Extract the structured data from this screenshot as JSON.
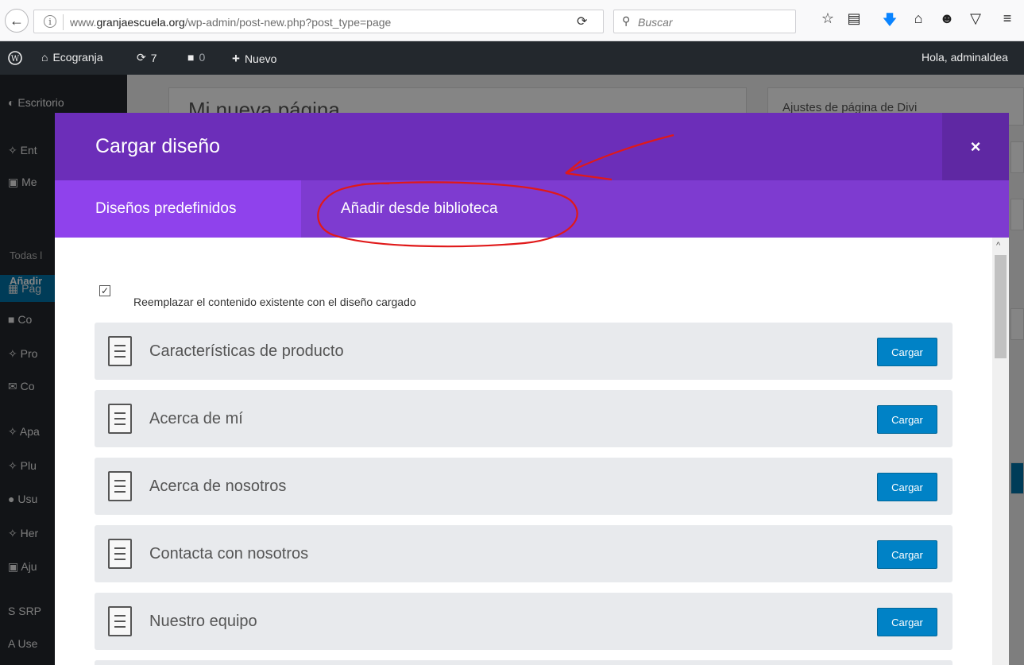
{
  "browser": {
    "url_prefix": "www.",
    "url_domain": "granjaescuela.org",
    "url_path": "/wp-admin/post-new.php?post_type=page",
    "search_placeholder": "Buscar"
  },
  "adminbar": {
    "site_name": "Ecogranja",
    "updates_count": "7",
    "comments_count": "0",
    "new_label": "Nuevo",
    "greeting": "Hola, adminaldea"
  },
  "underlay": {
    "page_title": "Mi nueva página",
    "side_box_title": "Ajustes de página de Divi",
    "sidebar": {
      "dashboard": "Escritorio",
      "posts": "Ent",
      "media": "Me",
      "pages": "Pág",
      "all_pages": "Todas l",
      "add_new": "Añadir",
      "comments": "Co",
      "projects": "Pro",
      "contact": "Co",
      "appearance": "Apa",
      "plugins": "Plu",
      "users": "Usu",
      "tools": "Her",
      "settings": "Aju",
      "srp": "SRP",
      "use": "Use"
    }
  },
  "modal": {
    "title": "Cargar diseño",
    "close_label": "×",
    "tabs": {
      "predefined": "Diseños predefinidos",
      "library": "Añadir desde biblioteca"
    },
    "replace_checkbox_label": "Reemplazar el contenido existente con el diseño cargado",
    "load_label": "Cargar",
    "layouts": [
      "Características de producto",
      "Acerca de mí",
      "Acerca de nosotros",
      "Contacta con nosotros",
      "Nuestro equipo"
    ]
  },
  "colors": {
    "modal_header": "#6c2eb9",
    "tabs_bar": "#7e3bd0",
    "active_tab": "#8f42ec",
    "load_button": "#0082c6",
    "annotation": "#e0191a"
  }
}
